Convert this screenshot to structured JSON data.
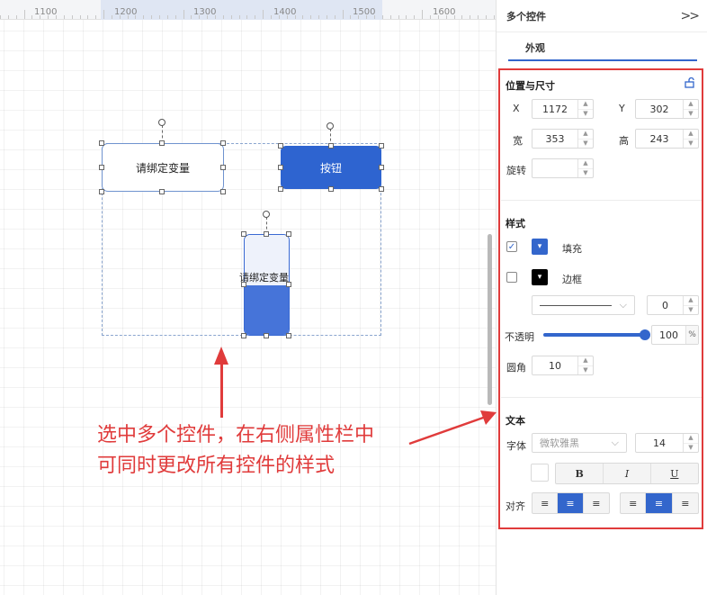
{
  "ruler": {
    "labels": [
      "1100",
      "1200",
      "1300",
      "1400",
      "1500",
      "1600"
    ]
  },
  "canvas": {
    "var_control_label": "请绑定变量",
    "button_control_label": "按钮",
    "vertical_control_label": "请绑定变量",
    "note_line1": "选中多个控件，在右侧属性栏中",
    "note_line2": "可同时更改所有控件的样式"
  },
  "panel": {
    "title": "多个控件",
    "collapse_icon": "double-chevron-right-icon",
    "tab": "外观",
    "position_size": {
      "title": "位置与尺寸",
      "x_label": "X",
      "x_value": "1172",
      "y_label": "Y",
      "y_value": "302",
      "w_label": "宽",
      "w_value": "353",
      "h_label": "高",
      "h_value": "243",
      "rotate_label": "旋转",
      "rotate_value": ""
    },
    "style": {
      "title": "样式",
      "fill_label": "填充",
      "fill_checked": true,
      "fill_color": "#3366cc",
      "border_label": "边框",
      "border_checked": false,
      "border_color": "#000000",
      "border_width": "0",
      "opacity_label": "不透明",
      "opacity_value": "100",
      "opacity_unit": "%",
      "radius_label": "圆角",
      "radius_value": "10"
    },
    "text": {
      "title": "文本",
      "font_label": "字体",
      "font_value": "微软雅黑",
      "font_size": "14",
      "bold": "B",
      "italic": "I",
      "underline": "U",
      "align_label": "对齐"
    }
  },
  "colors": {
    "accent": "#3366cc",
    "annotation": "#e03b3b"
  }
}
